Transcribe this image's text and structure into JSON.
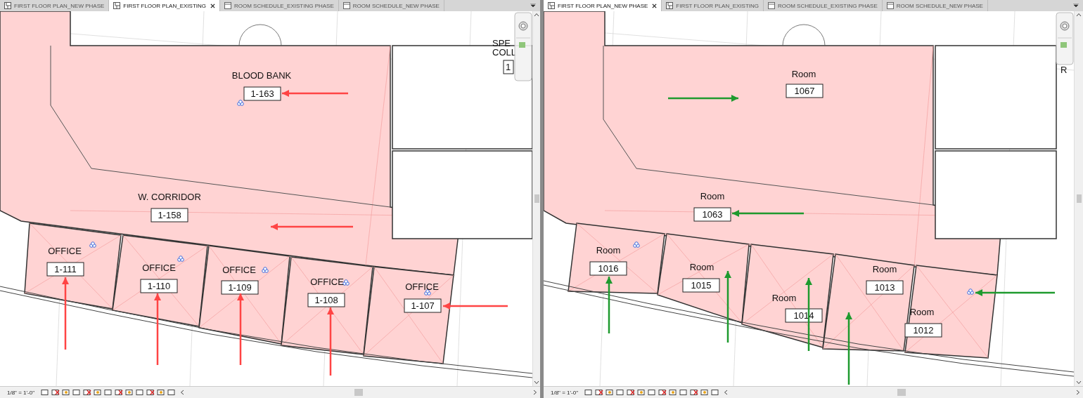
{
  "panels": [
    {
      "tabs": [
        {
          "label": "FIRST FLOOR PLAN_NEW PHASE",
          "kind": "plan",
          "selected": false
        },
        {
          "label": "FIRST FLOOR PLAN_EXISTING",
          "kind": "plan",
          "selected": true
        },
        {
          "label": "ROOM SCHEDULE_EXISTING PHASE",
          "kind": "schedule",
          "selected": false
        },
        {
          "label": "ROOM SCHEDULE_NEW PHASE",
          "kind": "schedule",
          "selected": false
        }
      ],
      "color": "#ff4444",
      "rooms": [
        {
          "name": "BLOOD BANK",
          "number": "1-163"
        },
        {
          "name": "W. CORRIDOR",
          "number": "1-158"
        },
        {
          "name": "OFFICE",
          "number": "1-111"
        },
        {
          "name": "OFFICE",
          "number": "1-110"
        },
        {
          "name": "OFFICE",
          "number": "1-109"
        },
        {
          "name": "OFFICE",
          "number": "1-108"
        },
        {
          "name": "OFFICE",
          "number": "1-107"
        }
      ],
      "cut_room": {
        "name_lines": [
          "SPE",
          "COLL"
        ],
        "number": "1"
      },
      "scale": "1/8\" = 1'-0\""
    },
    {
      "tabs": [
        {
          "label": "FIRST FLOOR PLAN_NEW PHASE",
          "kind": "plan",
          "selected": true
        },
        {
          "label": "FIRST FLOOR PLAN_EXISTING",
          "kind": "plan",
          "selected": false
        },
        {
          "label": "ROOM SCHEDULE_EXISTING PHASE",
          "kind": "schedule",
          "selected": false
        },
        {
          "label": "ROOM SCHEDULE_NEW PHASE",
          "kind": "schedule",
          "selected": false
        }
      ],
      "color": "#1e9a2e",
      "rooms": [
        {
          "name": "Room",
          "number": "1067"
        },
        {
          "name": "Room",
          "number": "1063"
        },
        {
          "name": "Room",
          "number": "1016"
        },
        {
          "name": "Room",
          "number": "1015"
        },
        {
          "name": "Room",
          "number": "1014"
        },
        {
          "name": "Room",
          "number": "1013"
        },
        {
          "name": "Room",
          "number": "1012"
        }
      ],
      "cut_room": {
        "name_lines": [
          "R"
        ]
      },
      "scale": "1/8\" = 1'-0\""
    }
  ]
}
